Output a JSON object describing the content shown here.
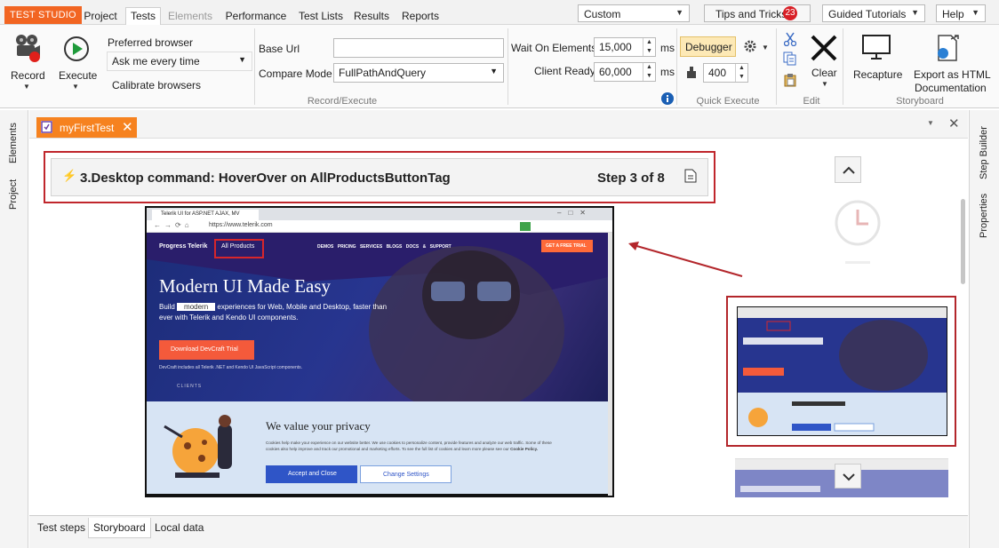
{
  "menubar": {
    "brand": "TEST STUDIO",
    "tabs": [
      {
        "label": "Project",
        "state": "normal"
      },
      {
        "label": "Tests",
        "state": "active"
      },
      {
        "label": "Elements",
        "state": "disabled"
      },
      {
        "label": "Performance",
        "state": "normal"
      },
      {
        "label": "Test Lists",
        "state": "normal"
      },
      {
        "label": "Results",
        "state": "normal"
      },
      {
        "label": "Reports",
        "state": "normal"
      }
    ],
    "layout_select": "Custom",
    "tips_label": "Tips and Tricks",
    "tips_count": "23",
    "tutorials_label": "Guided Tutorials",
    "help_label": "Help"
  },
  "ribbon": {
    "record_label": "Record",
    "execute_label": "Execute",
    "preferred_browser_label": "Preferred browser",
    "preferred_browser_value": "Ask me every time",
    "calibrate_label": "Calibrate browsers",
    "base_url_label": "Base Url",
    "base_url_value": "",
    "compare_mode_label": "Compare Mode",
    "compare_mode_value": "FullPathAndQuery",
    "record_execute_caption": "Record/Execute",
    "wait_on_elements_label": "Wait On Elements",
    "wait_on_elements_value": "15,000",
    "client_ready_label": "Client Ready",
    "client_ready_value": "60,000",
    "ms_unit": "ms",
    "debugger_label": "Debugger",
    "quick_value": "400",
    "quick_execute_caption": "Quick Execute",
    "clear_label": "Clear",
    "edit_caption": "Edit",
    "recapture_label": "Recapture",
    "export_label_line1": "Export as HTML",
    "export_label_line2": "Documentation",
    "storyboard_caption": "Storyboard"
  },
  "left_sidebar": {
    "items": [
      "Elements",
      "Project"
    ]
  },
  "right_sidebar": {
    "items": [
      "Step Builder",
      "Properties"
    ]
  },
  "document_tab": {
    "title": "myFirstTest"
  },
  "step": {
    "title": "3.Desktop command: HoverOver on AllProductsButtonTag",
    "counter": "Step 3 of 8"
  },
  "bottom_tabs": [
    "Test steps",
    "Storyboard",
    "Local data"
  ],
  "screenshot": {
    "tab_title": "Telerik UI for ASP.NET AJAX, MV",
    "url": "https://www.telerik.com",
    "logo": "Progress Telerik",
    "all_products": "All Products",
    "nav_items": [
      "DEMOS",
      "PRICING",
      "SERVICES",
      "BLOGS",
      "DOCS & SUPPORT"
    ],
    "cta": "GET A FREE TRIAL",
    "hero_title": "Modern UI Made Easy",
    "hero_line1_pre": "Build",
    "hero_highlight": "modern",
    "hero_line1_post": "experiences for Web, Mobile and Desktop, faster than",
    "hero_line2": "ever with Telerik and Kendo UI components.",
    "hero_button": "Download DevCraft Trial",
    "hero_note": "DevCraft includes all Telerik .NET and Kendo UI JavaScript components.",
    "privacy_title": "We value your privacy",
    "privacy_text1": "Cookies help make your experience on our website better. We use cookies to personalize content, provide features and analyze our web traffic. Some of these",
    "privacy_text2": "cookies also help improve and track our promotional and marketing efforts. To see the full list of cookies and learn more please see our",
    "privacy_link": "Cookie Policy.",
    "accept_button": "Accept and Close",
    "settings_button": "Change Settings",
    "clients_label": "CLIENTS"
  },
  "colors": {
    "brand": "#f26522",
    "highlight_red": "#c0262c",
    "hero_blue": "#27358f",
    "cta_orange": "#ff6a39",
    "accept_blue": "#2f55c7"
  }
}
